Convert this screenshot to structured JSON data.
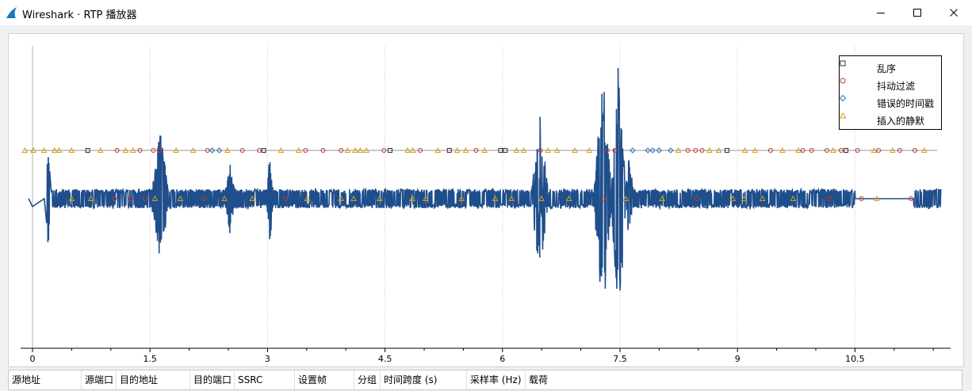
{
  "window": {
    "title": "Wireshark · RTP 播放器",
    "minimize_icon": "minimize-icon",
    "maximize_icon": "maximize-icon",
    "close_icon": "close-icon"
  },
  "legend": {
    "items": [
      {
        "label": "乱序",
        "marker": "square",
        "color": "#333333"
      },
      {
        "label": "抖动过滤",
        "marker": "circle",
        "color": "#c0392b"
      },
      {
        "label": "错误的时间戳",
        "marker": "diamond",
        "color": "#2e75b6"
      },
      {
        "label": "插入的静默",
        "marker": "triangle",
        "color": "#d4a017"
      }
    ]
  },
  "table": {
    "columns": [
      "源地址",
      "源端口",
      "目的地址",
      "目的端口",
      "SSRC",
      "设置帧",
      "分组",
      "时间跨度 (s)",
      "采样率 (Hz)",
      "载荷"
    ]
  },
  "chart_data": {
    "type": "line",
    "x_ticks": [
      "0",
      "1.5",
      "3",
      "4.5",
      "6",
      "7.5",
      "9",
      "10.5"
    ],
    "xlim": [
      -0.15,
      11.75
    ],
    "grid": "vertical dotted",
    "legend_position": "top-right",
    "waveform_color": "#1f4e8c",
    "marker_track_color": "#aaaaaa",
    "duration": 11.6
  }
}
